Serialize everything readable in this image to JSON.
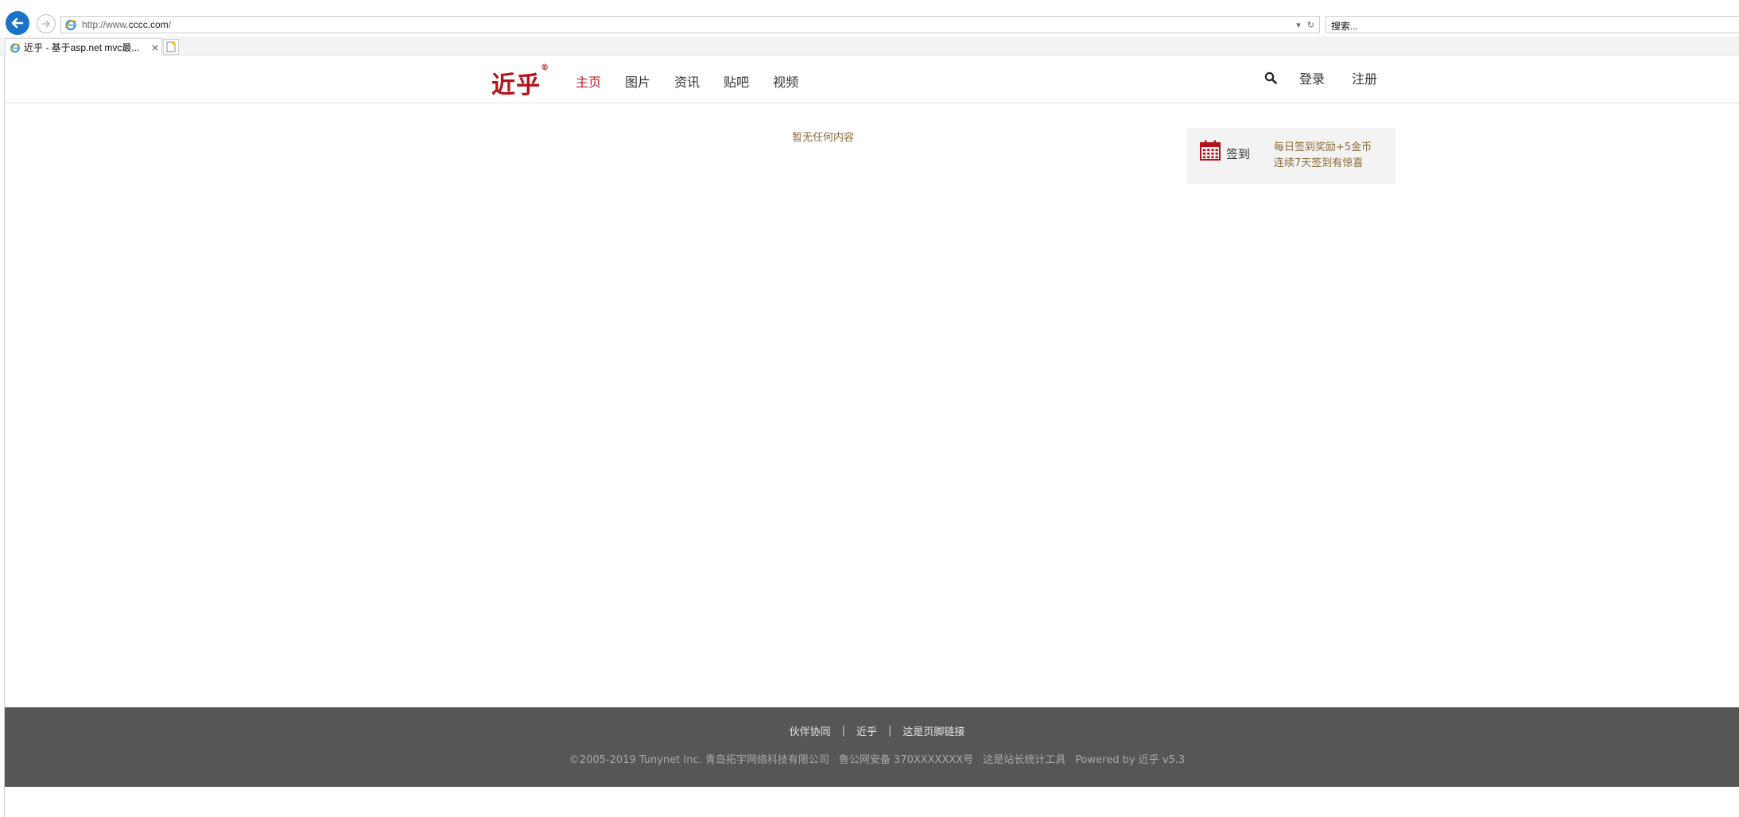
{
  "browser": {
    "url_prefix": "http://www.",
    "url_domain": "cccc.com",
    "url_suffix": "/",
    "search_placeholder": "搜索...",
    "tab_title": "近乎 - 基于asp.net mvc最...",
    "tab_close": "×",
    "addr_dropdown": "▾",
    "addr_refresh": "↻"
  },
  "header": {
    "logo": "近乎",
    "logo_mark": "®",
    "nav": [
      {
        "label": "主页",
        "active": true
      },
      {
        "label": "图片"
      },
      {
        "label": "资讯"
      },
      {
        "label": "贴吧"
      },
      {
        "label": "视频"
      }
    ],
    "login": "登录",
    "register": "注册"
  },
  "main": {
    "empty_text": "暂无任何内容"
  },
  "sign_in": {
    "label": "签到",
    "line1": "每日签到奖励+5金币",
    "line2": "连续7天签到有惊喜"
  },
  "footer": {
    "links": [
      "伙伴协同",
      "近乎",
      "这是页脚链接"
    ],
    "separator": "|",
    "copyright": "©2005-2019 Tunynet Inc. 青岛拓宇网络科技有限公司",
    "icp": "鲁公网安备 370XXXXXXX号",
    "stats": "这是站长统计工具",
    "powered": "Powered by 近乎 v5.3"
  },
  "colors": {
    "brand_red": "#b5121b",
    "nav_active": "#c81623",
    "note_brown": "#8b6b3a",
    "footer_bg": "#565656",
    "ie_blue": "#1a73c8"
  }
}
